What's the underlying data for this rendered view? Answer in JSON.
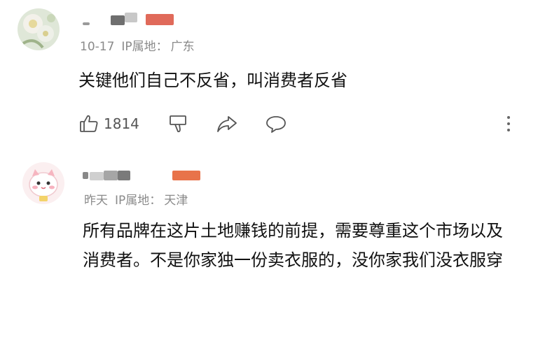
{
  "comments": [
    {
      "date": "10-17",
      "ip_label": "IP属地：",
      "ip_location": "广东",
      "text": "关键他们自己不反省，叫消费者反省",
      "likes": "1814",
      "icons": [
        "thumbs-up-icon",
        "thumbs-down-icon",
        "share-icon",
        "reply-bubble-icon",
        "more-vertical-icon"
      ]
    },
    {
      "date": "昨天",
      "ip_label": "IP属地：",
      "ip_location": "天津",
      "text": "所有品牌在这片土地赚钱的前提，需要尊重这个市场以及消费者。不是你家独一份卖衣服的，没你家我们没衣服穿"
    }
  ],
  "colors": {
    "meta": "#8a8a8a",
    "body_text": "#111111",
    "icon": "#555555",
    "badge_red": "#e06a5a",
    "badge_orange": "#e8734a"
  }
}
